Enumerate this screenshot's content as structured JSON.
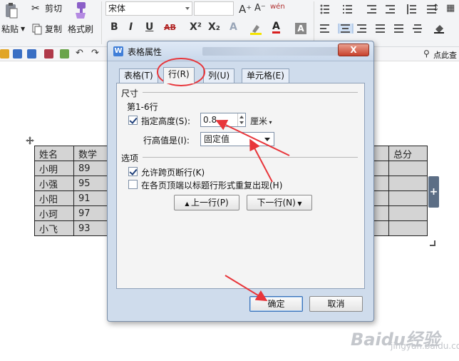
{
  "ribbon": {
    "paste_label": "粘贴",
    "cut_label": "剪切",
    "copy_label": "复制",
    "format_painter_label": "格式刷",
    "font_name": "宋体",
    "bold": "B",
    "italic": "I",
    "underline": "U",
    "strike": "AB",
    "superscript": "X²",
    "subscript": "X₂",
    "font_grow": "A⁺",
    "font_shrink": "A⁻",
    "clear_format": "wén",
    "font_color": "A",
    "quick_search_label": "点此查"
  },
  "doc_table": {
    "headers": [
      "姓名",
      "数学"
    ],
    "rows": [
      [
        "小明",
        "89"
      ],
      [
        "小强",
        "95"
      ],
      [
        "小阳",
        "91"
      ],
      [
        "小珂",
        "97"
      ],
      [
        "小飞",
        "93"
      ]
    ],
    "right_header": "总分"
  },
  "dialog": {
    "title": "表格属性",
    "close_label": "X",
    "tabs": [
      "表格(T)",
      "行(R)",
      "列(U)",
      "单元格(E)"
    ],
    "active_tab": "行(R)",
    "size_section": "尺寸",
    "rows_caption": "第1-6行",
    "specify_height_label": "指定高度(S):",
    "specify_height_checked": true,
    "height_value": "0.8",
    "height_unit": "厘米",
    "row_height_is_label": "行高值是(I):",
    "row_height_mode": "固定值",
    "options_section": "选项",
    "allow_break_label": "允许跨页断行(K)",
    "allow_break_checked": true,
    "repeat_header_label": "在各页顶端以标题行形式重复出现(H)",
    "repeat_header_checked": false,
    "prev_row_label": "上一行(P)",
    "next_row_label": "下一行(N)",
    "ok_label": "确定",
    "cancel_label": "取消"
  },
  "watermark": {
    "brand": "Baidu经验",
    "url": "jingyan.baidu.com"
  },
  "colors": {
    "annotation_red": "#e8353a",
    "dialog_bg": "#cfdcec",
    "table_cell": "#d4d4d4",
    "highlight_yellow": "#f5e400",
    "font_color_red": "#d81e1e"
  }
}
